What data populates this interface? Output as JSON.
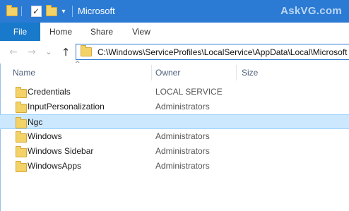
{
  "window": {
    "title": "Microsoft",
    "watermark": "AskVG.com"
  },
  "ribbon": {
    "tabs": [
      "File",
      "Home",
      "Share",
      "View"
    ]
  },
  "nav": {
    "back_glyph": "←",
    "forward_glyph": "→",
    "recent_glyph": "⌄",
    "up_glyph": "↑",
    "address": "C:\\Windows\\ServiceProfiles\\LocalService\\AppData\\Local\\Microsoft"
  },
  "columns": {
    "name": "Name",
    "owner": "Owner",
    "size": "Size"
  },
  "files": [
    {
      "name": "Credentials",
      "owner": "LOCAL SERVICE",
      "selected": false
    },
    {
      "name": "InputPersonalization",
      "owner": "Administrators",
      "selected": false
    },
    {
      "name": "Ngc",
      "owner": "",
      "selected": true
    },
    {
      "name": "Windows",
      "owner": "Administrators",
      "selected": false
    },
    {
      "name": "Windows Sidebar",
      "owner": "Administrators",
      "selected": false
    },
    {
      "name": "WindowsApps",
      "owner": "Administrators",
      "selected": false
    }
  ],
  "colors": {
    "title_bar": "#2b7bd4",
    "file_tab": "#1979ca",
    "selection": "#cce8ff",
    "folder": "#f3d268"
  }
}
